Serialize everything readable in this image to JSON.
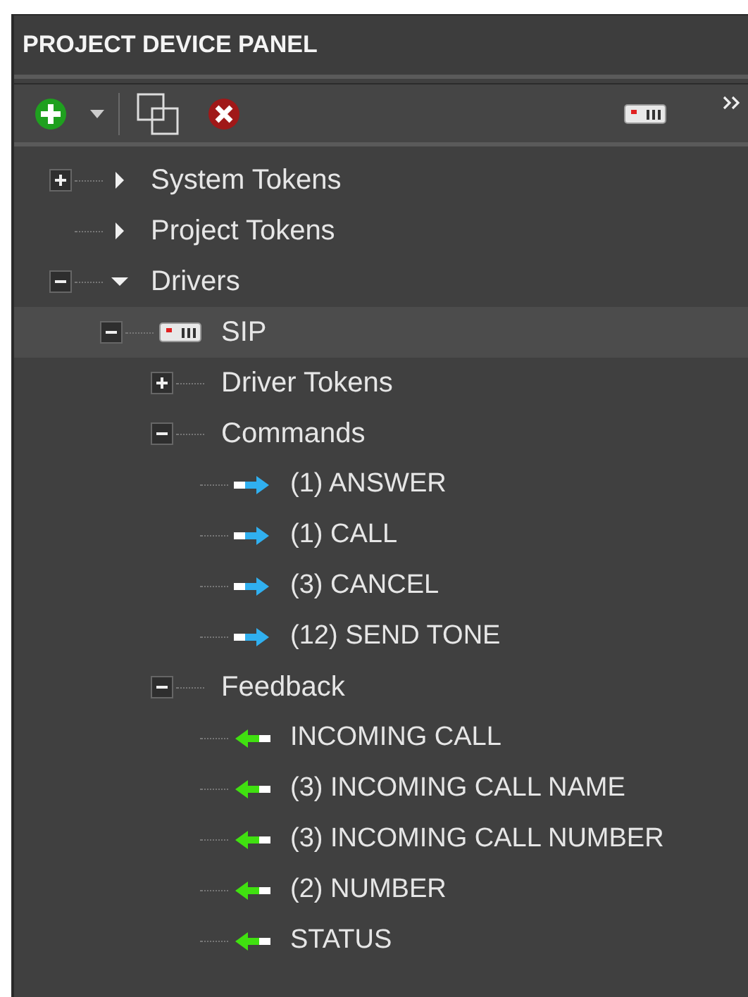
{
  "panel": {
    "title": "PROJECT DEVICE PANEL"
  },
  "tree": [
    {
      "kind": "category",
      "label": "System Tokens",
      "expandable": true,
      "expanded": false,
      "selected": false
    },
    {
      "kind": "category",
      "label": "Project Tokens",
      "expandable": false,
      "expanded": false,
      "selected": false
    },
    {
      "kind": "category",
      "label": "Drivers",
      "expandable": true,
      "expanded": true,
      "selected": false,
      "children": [
        {
          "kind": "device",
          "label": "SIP",
          "expandable": true,
          "expanded": true,
          "selected": true,
          "children": [
            {
              "kind": "group",
              "label": "Driver Tokens",
              "expandable": true,
              "expanded": false,
              "selected": false
            },
            {
              "kind": "group",
              "label": "Commands",
              "expandable": true,
              "expanded": true,
              "selected": false,
              "children": [
                {
                  "kind": "command",
                  "label": "(1) ANSWER",
                  "selected": false
                },
                {
                  "kind": "command",
                  "label": "(1) CALL",
                  "selected": false
                },
                {
                  "kind": "command",
                  "label": "(3) CANCEL",
                  "selected": false
                },
                {
                  "kind": "command",
                  "label": "(12) SEND TONE",
                  "selected": false
                }
              ]
            },
            {
              "kind": "group",
              "label": "Feedback",
              "expandable": true,
              "expanded": true,
              "selected": false,
              "children": [
                {
                  "kind": "feedback",
                  "label": "INCOMING CALL",
                  "selected": false
                },
                {
                  "kind": "feedback",
                  "label": "(3) INCOMING CALL NAME",
                  "selected": false
                },
                {
                  "kind": "feedback",
                  "label": "(3) INCOMING CALL NUMBER",
                  "selected": false
                },
                {
                  "kind": "feedback",
                  "label": "(2) NUMBER",
                  "selected": false
                },
                {
                  "kind": "feedback",
                  "label": "STATUS",
                  "selected": false
                }
              ]
            }
          ]
        }
      ]
    }
  ]
}
